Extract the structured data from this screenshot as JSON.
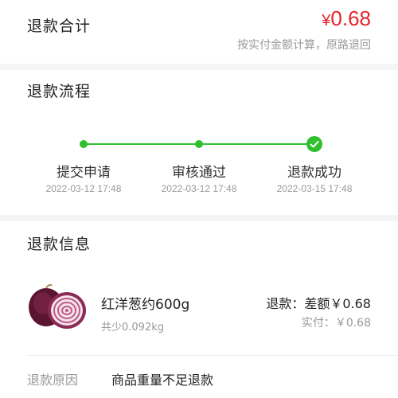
{
  "total": {
    "title": "退款合计",
    "currency": "¥",
    "amount": "0.68",
    "note": "按实付金额计算，原路退回",
    "accent_color": "#e5242b"
  },
  "flow": {
    "title": "退款流程",
    "status_color": "#2fbf2f",
    "steps": [
      {
        "label": "提交申请",
        "time": "2022-03-12 17:48",
        "icon": "dot"
      },
      {
        "label": "审核通过",
        "time": "2022-03-12 17:48",
        "icon": "dot"
      },
      {
        "label": "退款成功",
        "time": "2022-03-15 17:48",
        "icon": "check-circle-icon"
      }
    ]
  },
  "info": {
    "title": "退款信息",
    "product": {
      "image_icon": "red-onion-image",
      "name": "红洋葱约600g",
      "weight_note": "共少0.092kg",
      "refund_text": "退款：差额￥0.68",
      "paid_text": "实付：￥0.68"
    },
    "reason_label": "退款原因",
    "reason_value": "商品重量不足退款"
  }
}
